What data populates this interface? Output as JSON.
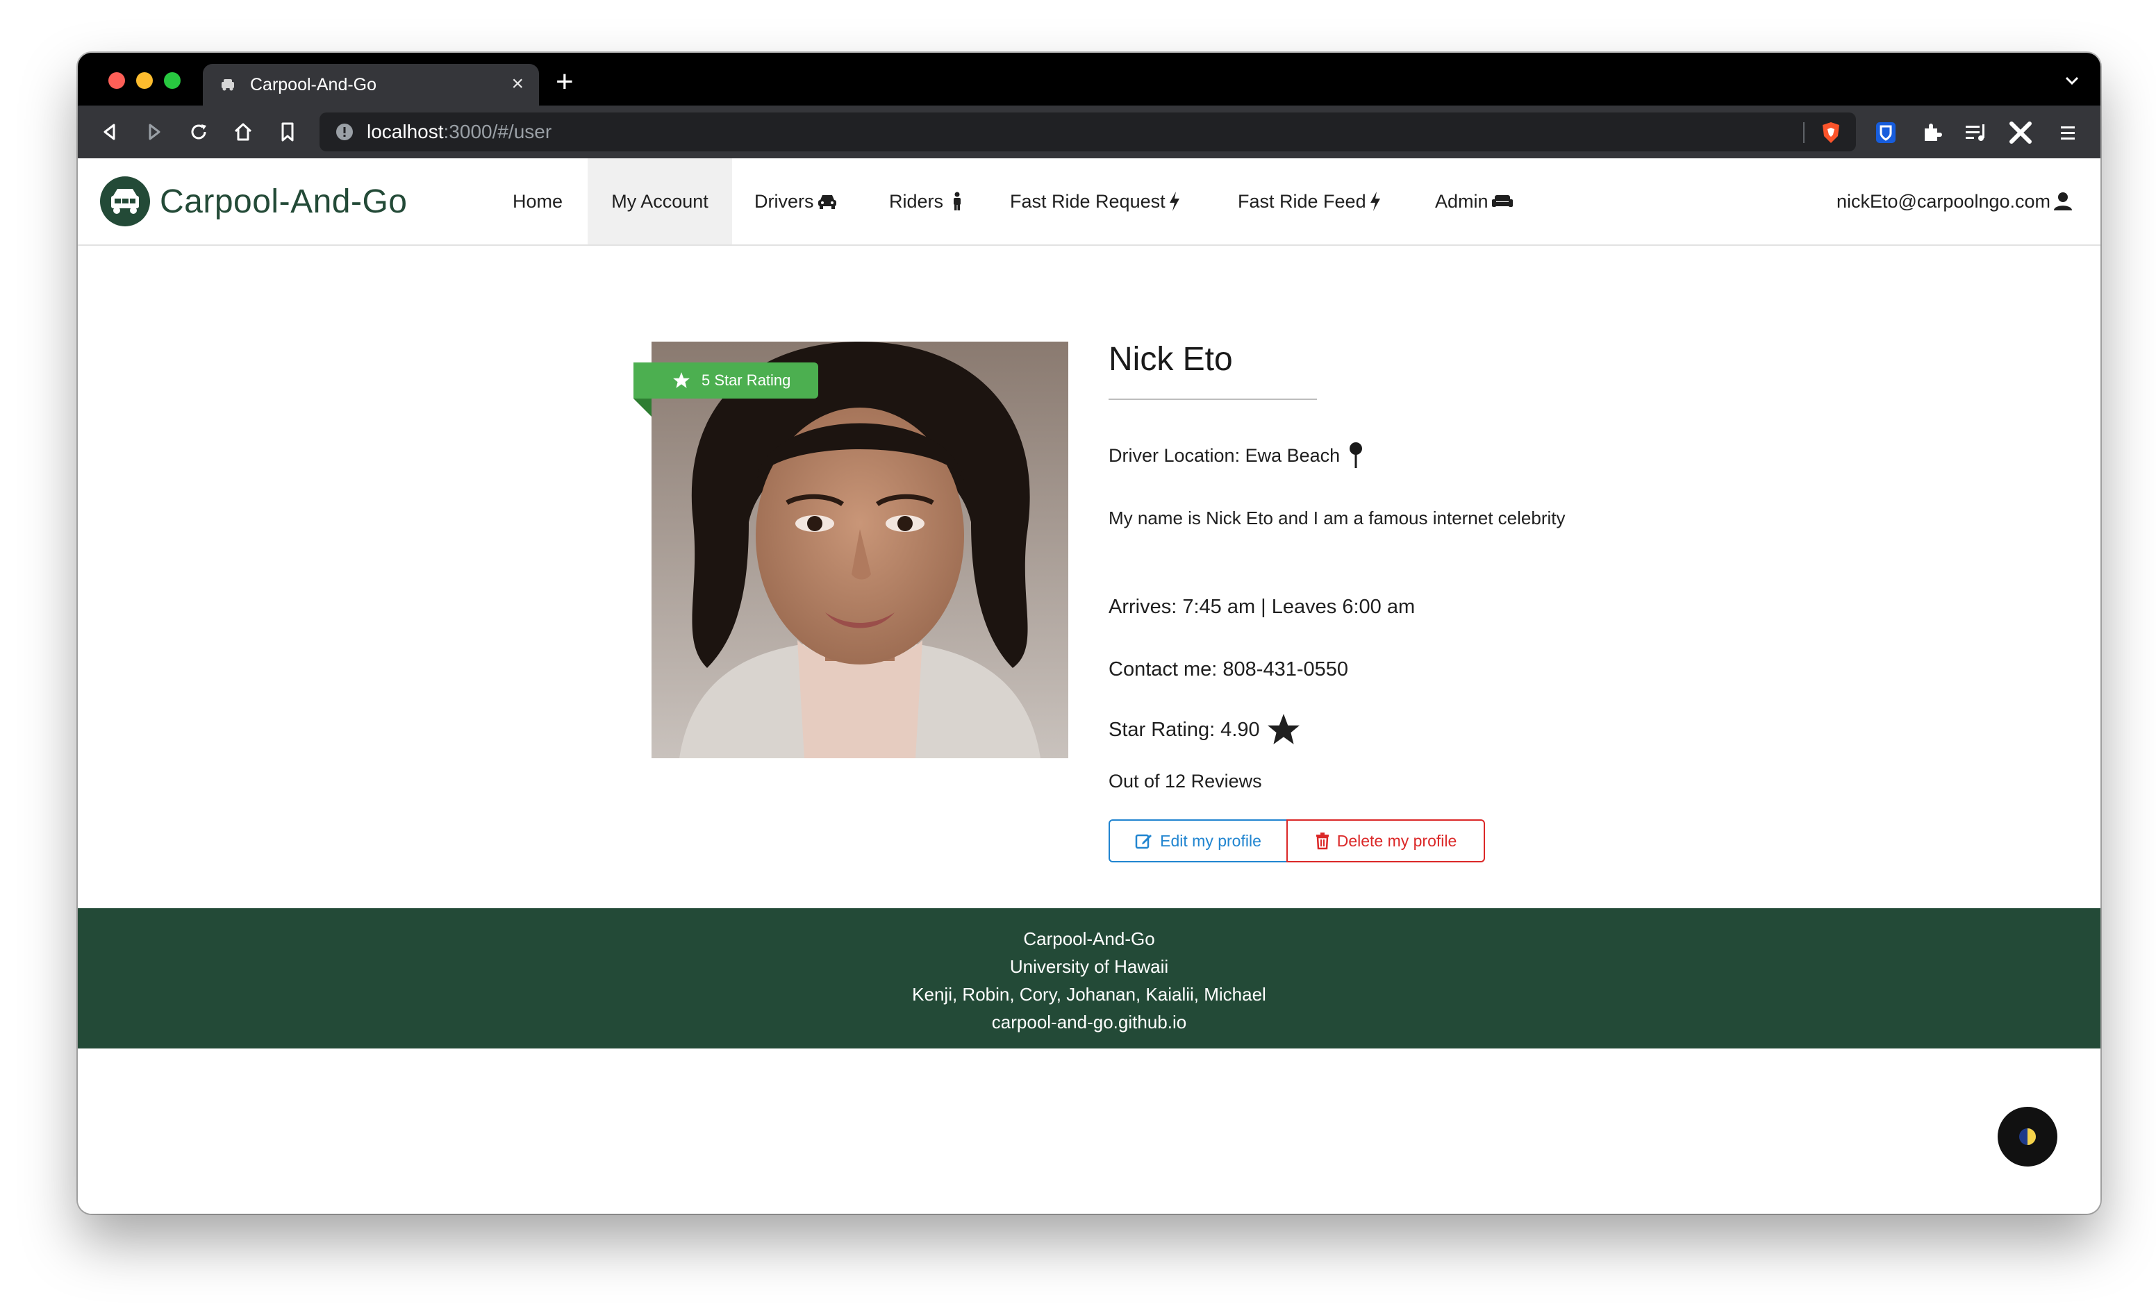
{
  "browser": {
    "tab_title": "Carpool-And-Go",
    "url_host": "localhost",
    "url_path": ":3000/#/user"
  },
  "navbar": {
    "brand": "Carpool-And-Go",
    "items": [
      {
        "label": "Home"
      },
      {
        "label": "My Account"
      },
      {
        "label": "Drivers"
      },
      {
        "label": "Riders"
      },
      {
        "label": "Fast Ride Request"
      },
      {
        "label": "Fast Ride Feed"
      },
      {
        "label": "Admin"
      }
    ],
    "user_email": "nickEto@carpoolngo.com"
  },
  "profile": {
    "ribbon": "5 Star Rating",
    "name": "Nick Eto",
    "location": "Driver Location: Ewa Beach",
    "bio": "My name is Nick Eto and I am a famous internet celebrity",
    "schedule": "Arrives: 7:45 am | Leaves 6:00 am",
    "contact": "Contact me: 808-431-0550",
    "rating": "Star Rating: 4.90",
    "reviews": "Out of 12 Reviews",
    "edit_label": "Edit my profile",
    "delete_label": "Delete my profile"
  },
  "footer": {
    "line1": "Carpool-And-Go",
    "line2": "University of Hawaii",
    "line3": "Kenji, Robin, Cory, Johanan, Kaialii, Michael",
    "line4": "carpool-and-go.github.io"
  },
  "colors": {
    "brand_green": "#234a37",
    "ribbon_green": "#4caf50",
    "edit_blue": "#2185d0",
    "delete_red": "#db2828"
  }
}
